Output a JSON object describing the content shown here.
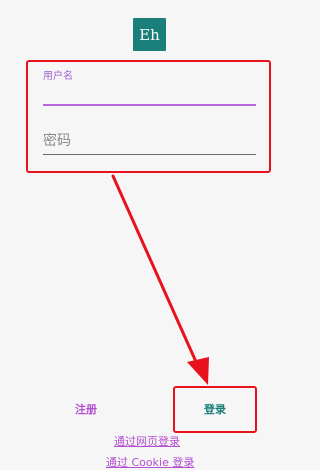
{
  "logo": {
    "text": "Eh"
  },
  "form": {
    "username_label": "用户名",
    "username_value": "",
    "password_placeholder": "密码",
    "password_value": ""
  },
  "actions": {
    "register_label": "注册",
    "login_label": "登录",
    "web_login_label": "通过网页登录",
    "cookie_login_label": "通过 Cookie 登录"
  },
  "colors": {
    "brand": "#1a7f7a",
    "accent": "#b34fd0",
    "annotation": "#e8121f"
  }
}
